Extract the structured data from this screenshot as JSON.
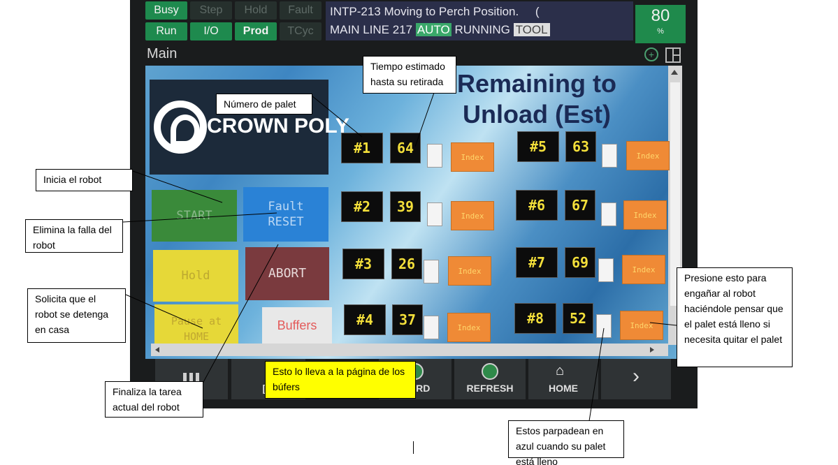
{
  "status_bar": {
    "buttons": [
      {
        "label": "Busy",
        "active": true
      },
      {
        "label": "Step",
        "active": false
      },
      {
        "label": "Hold",
        "active": false
      },
      {
        "label": "Fault",
        "active": false
      },
      {
        "label": "Run",
        "active": true
      },
      {
        "label": "I/O",
        "active": true
      },
      {
        "label": "Prod",
        "active": true
      },
      {
        "label": "TCyc",
        "active": false
      }
    ],
    "message_line1": "INTP-213 Moving to Perch Position.     (",
    "message_line2_prefix": "MAIN LINE 217",
    "message_auto": "AUTO",
    "message_running": "RUNNING",
    "message_tool": "TOOL",
    "speed_value": "80",
    "speed_unit": "%"
  },
  "window": {
    "title": "Main",
    "zoom_icon": "zoom-in-icon",
    "layout_icon": "split-window-icon"
  },
  "hmi": {
    "logo_text": "CROWN POLY",
    "remaining_title_line1": "Remaining to",
    "remaining_title_line2": "Unload (Est)",
    "buttons": {
      "start": "START",
      "fault_reset_line1": "Fault",
      "fault_reset_line2": "RESET",
      "hold": "Hold",
      "abort": "ABORT",
      "pause_line1": "Pause at",
      "pause_line2": "HOME",
      "buffers": "Buffers"
    },
    "pallets": [
      {
        "id": "#1",
        "remaining": "64",
        "index_label": "Index"
      },
      {
        "id": "#2",
        "remaining": "39",
        "index_label": "Index"
      },
      {
        "id": "#3",
        "remaining": "26",
        "index_label": "Index"
      },
      {
        "id": "#4",
        "remaining": "37",
        "index_label": "Index"
      },
      {
        "id": "#5",
        "remaining": "63",
        "index_label": "Index"
      },
      {
        "id": "#6",
        "remaining": "67",
        "index_label": "Index"
      },
      {
        "id": "#7",
        "remaining": "69",
        "index_label": "Index"
      },
      {
        "id": "#8",
        "remaining": "52",
        "index_label": "Index"
      }
    ]
  },
  "function_keys": {
    "key2_label": "[ T",
    "key3_label": "WARD",
    "refresh": "REFRESH",
    "home": "HOME",
    "next_arrow": "›"
  },
  "callouts": {
    "pallet_number": "Número de palet",
    "time_estimate": "Tiempo estimado hasta su retirada",
    "start_robot": "Inicia el robot",
    "clear_fault": "Elimina la falla del robot",
    "request_stop": "Solicita que el robot se detenga en casa",
    "end_task": "Finaliza la tarea actual del robot",
    "buffers_page": "Esto lo lleva a la página de los búfers",
    "index_trick": "Presione esto para engañar al robot haciéndole pensar que el palet está lleno si necesita quitar el palet",
    "blink_blue": "Estos parpadean en azul cuando su palet está lleno"
  },
  "colors": {
    "status_active": "#1e8a4e",
    "index_orange": "#ef8a36",
    "pallet_text_yellow": "#f3df3a",
    "callout_highlight": "#ffff00"
  }
}
